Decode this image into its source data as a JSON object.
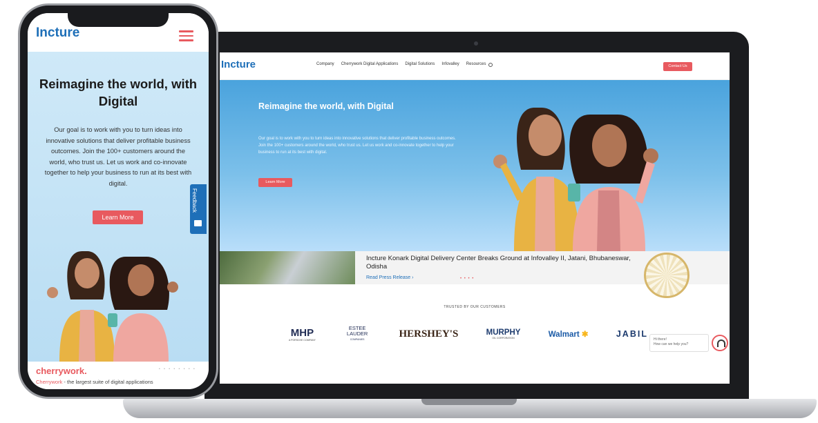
{
  "brand": {
    "name": "Incture",
    "accent": "#e85a5f",
    "primary": "#1e6fb8"
  },
  "desktop": {
    "nav": {
      "items": [
        "Company",
        "Cherrywork Digital Applications",
        "Digital Solutions",
        "Infovalley",
        "Resources"
      ],
      "search_icon": "search-icon",
      "contact_label": "Contact Us"
    },
    "hero": {
      "title": "Reimagine the world, with Digital",
      "text": "Our goal is to work with you to turn ideas into innovative solutions that deliver profitable business outcomes. Join the 100+ customers around the world, who trust us. Let us work and co-innovate together to help your business to run at its best with digital.",
      "cta": "Learn More"
    },
    "news": {
      "title": "Incture Konark Digital Delivery Center Breaks Ground at Infovalley II, Jatani, Bhubaneswar, Odisha",
      "link": "Read Press Release ›",
      "dots": "• • • •"
    },
    "trusted": {
      "heading": "TRUSTED BY OUR CUSTOMERS",
      "logos": {
        "mhp": "MHP",
        "mhp_sub": "A PORSCHE COMPANY",
        "estee": "ESTEE LAUDER",
        "estee_sub": "COMPANIES",
        "hershey": "HERSHEY'S",
        "murphy": "MURPHY",
        "murphy_sub": "OIL CORPORATION",
        "walmart": "Walmart",
        "jabil": "JABIL"
      }
    },
    "chat": {
      "line1": "Hi there!",
      "line2": "How can we help you?"
    }
  },
  "mobile": {
    "logo": "Incture",
    "hero": {
      "title": "Reimagine the world, with Digital",
      "text": "Our goal is to work with you to turn ideas into innovative solutions that deliver profitable business outcomes. Join the 100+ customers around the world, who trust us. Let us work and co-innovate together to help your business to run at its best with digital.",
      "cta": "Learn More"
    },
    "feedback_label": "Feedback",
    "footer": {
      "brand": "cherrywork.",
      "tagline_brand": "Cherrywork",
      "tagline": " - the largest suite of digital applications"
    }
  }
}
